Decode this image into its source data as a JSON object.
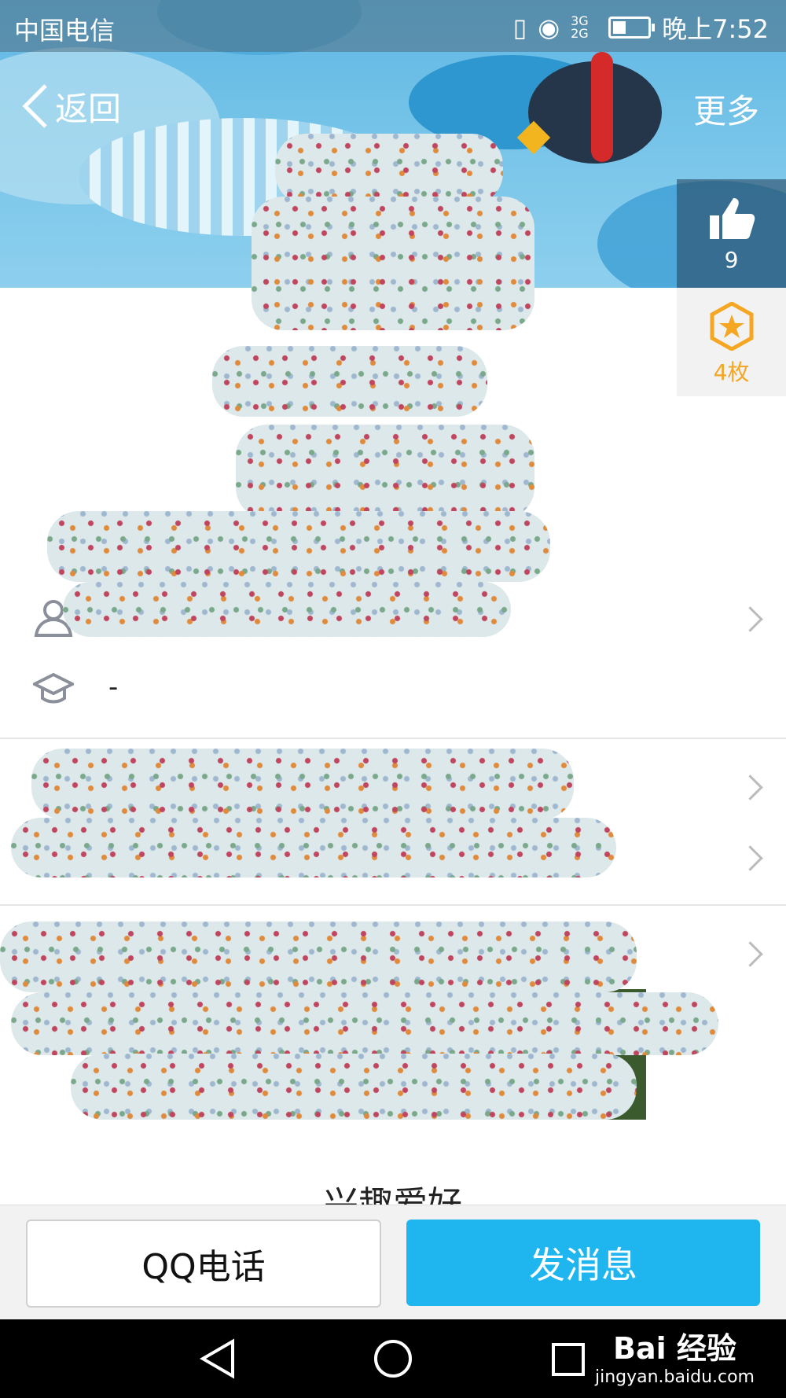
{
  "status_bar": {
    "carrier": "中国电信",
    "network": "3G 2G",
    "time": "晚上7:52"
  },
  "nav": {
    "back_label": "返回",
    "more_label": "更多"
  },
  "rail": {
    "like_count": "9",
    "medal_count": "4枚"
  },
  "info_rows": {
    "education_value": "-"
  },
  "section": {
    "interests_title": "兴趣爱好"
  },
  "bottom_bar": {
    "phone_label": "QQ电话",
    "message_label": "发消息"
  },
  "watermark": {
    "brand": "Bai 经验",
    "url": "jingyan.baidu.com"
  },
  "colors": {
    "accent": "#1fb6f0",
    "medal": "#f5a623"
  }
}
